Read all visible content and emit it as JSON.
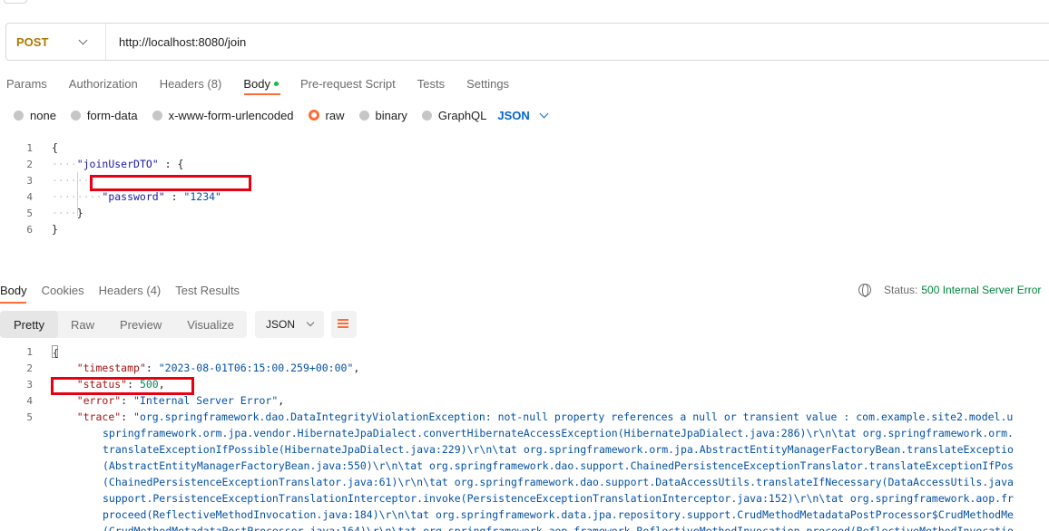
{
  "request": {
    "method": "POST",
    "url": "http://localhost:8080/join",
    "tabs": [
      {
        "label": "Params"
      },
      {
        "label": "Authorization"
      },
      {
        "label": "Headers (8)"
      },
      {
        "label": "Body"
      },
      {
        "label": "Pre-request Script"
      },
      {
        "label": "Tests"
      },
      {
        "label": "Settings"
      }
    ],
    "body_types": [
      {
        "label": "none"
      },
      {
        "label": "form-data"
      },
      {
        "label": "x-www-form-urlencoded"
      },
      {
        "label": "raw"
      },
      {
        "label": "binary"
      },
      {
        "label": "GraphQL"
      }
    ],
    "body_format": "JSON",
    "body_lines": [
      "1",
      "2",
      "3",
      "4",
      "5",
      "6"
    ],
    "body_code": {
      "l1": "{",
      "l2_key": "\"joinUserDTO\"",
      "l2_rest": " : {",
      "l4_key": "\"password\"",
      "l4_sep": " : ",
      "l4_val": "\"1234\"",
      "l5": "}",
      "l6": "}"
    }
  },
  "response": {
    "tabs": [
      {
        "label": "Body"
      },
      {
        "label": "Cookies"
      },
      {
        "label": "Headers (4)"
      },
      {
        "label": "Test Results"
      }
    ],
    "status_label": "Status:",
    "status_value": "500 Internal Server Error",
    "view_modes": [
      {
        "label": "Pretty"
      },
      {
        "label": "Raw"
      },
      {
        "label": "Preview"
      },
      {
        "label": "Visualize"
      }
    ],
    "format": "JSON",
    "lines": [
      "1",
      "2",
      "3",
      "4",
      "5"
    ],
    "code": {
      "l1": "{",
      "timestamp_key": "\"timestamp\"",
      "timestamp_val": "\"2023-08-01T06:15:00.259+00:00\"",
      "status_key": "\"status\"",
      "status_val": "500",
      "error_key": "\"error\"",
      "error_val": "\"Internal Server Error\"",
      "trace_key": "\"trace\"",
      "trace_lines": [
        "\"org.springframework.dao.DataIntegrityViolationException: not-null property references a null or transient value : com.example.site2.model.u",
        "springframework.orm.jpa.vendor.HibernateJpaDialect.convertHibernateAccessException(HibernateJpaDialect.java:286)\\r\\n\\tat org.springframework.orm.",
        "translateExceptionIfPossible(HibernateJpaDialect.java:229)\\r\\n\\tat org.springframework.orm.jpa.AbstractEntityManagerFactoryBean.translateExceptio",
        "(AbstractEntityManagerFactoryBean.java:550)\\r\\n\\tat org.springframework.dao.support.ChainedPersistenceExceptionTranslator.translateExceptionIfPos",
        "(ChainedPersistenceExceptionTranslator.java:61)\\r\\n\\tat org.springframework.dao.support.DataAccessUtils.translateIfNecessary(DataAccessUtils.java",
        "support.PersistenceExceptionTranslationInterceptor.invoke(PersistenceExceptionTranslationInterceptor.java:152)\\r\\n\\tat org.springframework.aop.fr",
        "proceed(ReflectiveMethodInvocation.java:184)\\r\\n\\tat org.springframework.data.jpa.repository.support.CrudMethodMetadataPostProcessor$CrudMethodMe",
        "(CrudMethodMetadataPostProcessor.java:164)\\r\\n\\tat org.springframework.aop.framework.ReflectiveMethodInvocation.proceed(ReflectiveMethodInvocatio"
      ]
    }
  },
  "colors": {
    "accent": "#ff6c37",
    "method": "#ad7a03",
    "status_ok_text": "#00863c",
    "highlight": "#e60012"
  }
}
